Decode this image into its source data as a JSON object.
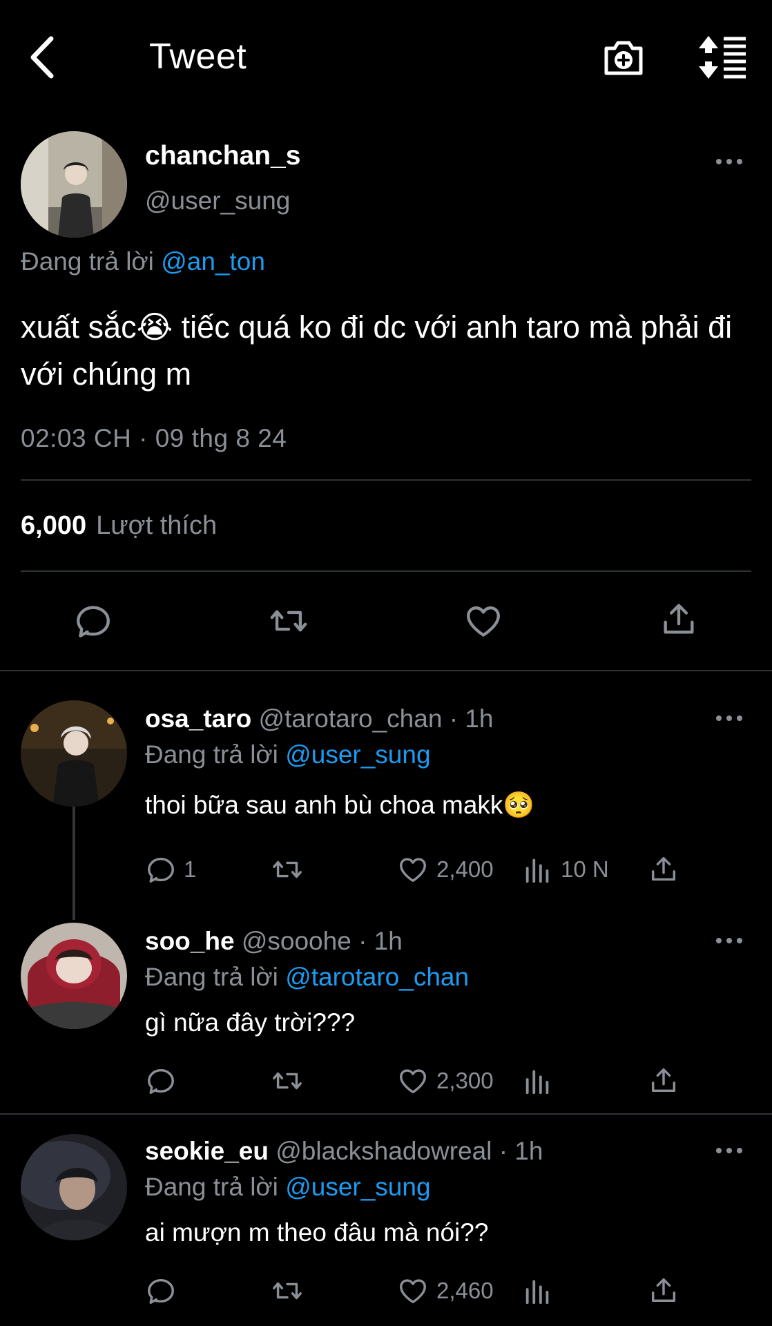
{
  "header": {
    "title": "Tweet"
  },
  "main_tweet": {
    "display_name": "chanchan_s",
    "handle": "@user_sung",
    "replying_prefix": "Đang trả lời",
    "replying_to": "@an_ton",
    "text": "xuất sắc😭  tiếc quá ko đi dc với anh taro mà phải đi với chúng m",
    "timestamp": "02:03 CH · 09 thg 8 24",
    "like_count": "6,000",
    "like_label": "Lượt thích"
  },
  "replies": [
    {
      "display_name": "osa_taro",
      "handle": "@tarotaro_chan",
      "sep": "·",
      "time": "1h",
      "replying_prefix": "Đang trả lời",
      "replying_to": "@user_sung",
      "text": "thoi bữa sau anh bù choa makk🥺",
      "reply_count": "1",
      "like_count": "2,400",
      "view_count": "10 N"
    },
    {
      "display_name": "soo_he",
      "handle": "@sooohe",
      "sep": "·",
      "time": "1h",
      "replying_prefix": "Đang trả lời",
      "replying_to": "@tarotaro_chan",
      "text": "gì nữa đây trời???",
      "reply_count": "",
      "like_count": "2,300",
      "view_count": ""
    },
    {
      "display_name": "seokie_eu",
      "handle": "@blackshadowreal",
      "sep": "·",
      "time": "1h",
      "replying_prefix": "Đang trả lời",
      "replying_to": "@user_sung",
      "text": "ai mượn m theo đâu mà nói??",
      "reply_count": "",
      "like_count": "2,460",
      "view_count": ""
    }
  ],
  "icons": {
    "back": "chevron-left-icon",
    "camera": "camera-plus-icon",
    "sort": "sort-icon",
    "reply": "reply-icon",
    "retweet": "retweet-icon",
    "like": "heart-icon",
    "share": "share-icon",
    "views": "views-icon",
    "more": "more-icon"
  },
  "colors": {
    "background": "#000000",
    "accent": "#1d9bf0",
    "secondary_text": "#8b9097",
    "divider": "#2f3336"
  }
}
